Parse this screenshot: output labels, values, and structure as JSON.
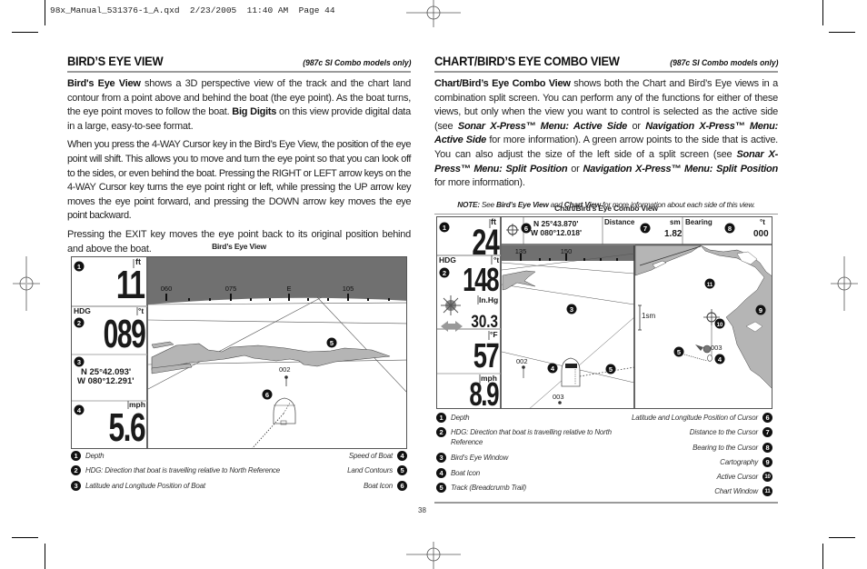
{
  "slug_line": "98x_Manual_531376-1_A.qxd  2/23/2005  11:40 AM  Page 44",
  "page_number": "38",
  "left": {
    "title": "BIRD’S EYE VIEW",
    "subtitle": "(987c SI Combo models only)",
    "para1": {
      "b1": "Bird's Eye View",
      "t1": " shows a 3D perspective view of the track and the chart land contour from a point above and behind the boat (the eye point). As the boat turns, the eye point moves to follow the boat. ",
      "b2": "Big Digits",
      "t2": " on this view provide digital data in a large, easy-to-see format."
    },
    "para2": "When you press the 4-WAY Cursor key in the Bird’s Eye View, the position of the eye point will shift. This allows you to move and turn the eye point so that you can look off to the sides, or even behind the boat. Pressing the RIGHT or LEFT arrow keys on the 4-WAY Cursor key turns the eye point right or left, while pressing the UP arrow key moves the eye point forward, and pressing the DOWN arrow key moves the eye point backward.",
    "para3": "Pressing the EXIT key moves the eye point back to its original position behind and above the boat.",
    "figure_caption": "Bird’s Eye View",
    "screen": {
      "depth_unit": "ft",
      "depth": "11",
      "hdg_label": "HDG",
      "hdg_unit": "°t",
      "hdg": "089",
      "lat": "N 25°42.093'",
      "lon": "W 080°12.291'",
      "speed_unit": "mph",
      "speed": "5.6",
      "compass_ticks": [
        "060",
        "075",
        "E",
        "105"
      ],
      "waypoint": "002"
    },
    "callouts_left": [
      {
        "num": "1",
        "text": "Depth"
      },
      {
        "num": "2",
        "text": "HDG: Direction that boat is travelling relative to North Reference"
      },
      {
        "num": "3",
        "text": "Latitude and Longitude Position of Boat"
      }
    ],
    "callouts_right": [
      {
        "num": "4",
        "text": "Speed of Boat"
      },
      {
        "num": "5",
        "text": "Land Contours"
      },
      {
        "num": "6",
        "text": "Boat Icon"
      }
    ]
  },
  "right": {
    "title": "CHART/BIRD’S EYE COMBO VIEW",
    "subtitle": "(987c SI Combo models only)",
    "para1": {
      "b1": "Chart/Bird’s Eye Combo View",
      "t1": " shows both the Chart and Bird’s Eye views in a combination split screen. You can perform any of the functions for either of these views, but only when the view you want to control is selected as the active side (see ",
      "bi1": "Sonar X-Press™ Menu: Active Side",
      "t2": " or ",
      "bi2": "Navigation X-Press™ Menu: Active Side",
      "t3": " for more information). A green arrow points to the side that is active.  You can also adjust the size of the left side of a split screen (see ",
      "bi3": "Sonar X-Press™ Menu: Split Position",
      "t4": " or ",
      "bi4": "Navigation X-Press™ Menu: Split Position",
      "t5": " for more information)."
    },
    "note": {
      "label": "NOTE:",
      "t1": " See ",
      "b1": "Bird’s Eye View",
      "t2": " and ",
      "b2": "Chart View",
      "t3": " for more information about each side of this view."
    },
    "figure_caption": "Chart/Bird’s Eye Combo View",
    "screen": {
      "depth_unit": "ft",
      "depth": "24",
      "hdg_label": "HDG",
      "hdg_unit": "°t",
      "hdg": "148",
      "baro_unit": "In.Hg",
      "baro": "30.3",
      "temp_unit": "°F",
      "temp": "57",
      "speed_unit": "mph",
      "speed": "8.9",
      "cursor_lat": "N 25°43.870'",
      "cursor_lon": "W 080°12.018'",
      "distance_label": "Distance",
      "distance_unit": "sm",
      "distance": "1.82",
      "bearing_label": "Bearing",
      "bearing_unit": "°t",
      "bearing": "000",
      "compass_ticks": [
        "135",
        "150"
      ],
      "scale_label": "1sm",
      "waypoints": [
        "002",
        "003"
      ],
      "chart_waypoint": "003"
    },
    "callouts_left": [
      {
        "num": "1",
        "text": "Depth"
      },
      {
        "num": "2",
        "text": "HDG: Direction that boat is travelling relative to North Reference"
      },
      {
        "num": "3",
        "text": "Bird’s Eye Window"
      },
      {
        "num": "4",
        "text": "Boat Icon"
      },
      {
        "num": "5",
        "text": "Track (Breadcrumb Trail)"
      }
    ],
    "callouts_right": [
      {
        "num": "6",
        "text": "Latitude and Longitude Position of Cursor"
      },
      {
        "num": "7",
        "text": "Distance to the Cursor"
      },
      {
        "num": "8",
        "text": "Bearing to the Cursor"
      },
      {
        "num": "9",
        "text": "Cartography"
      },
      {
        "num": "10",
        "text": "Active Cursor"
      },
      {
        "num": "11",
        "text": "Chart Window"
      }
    ]
  }
}
